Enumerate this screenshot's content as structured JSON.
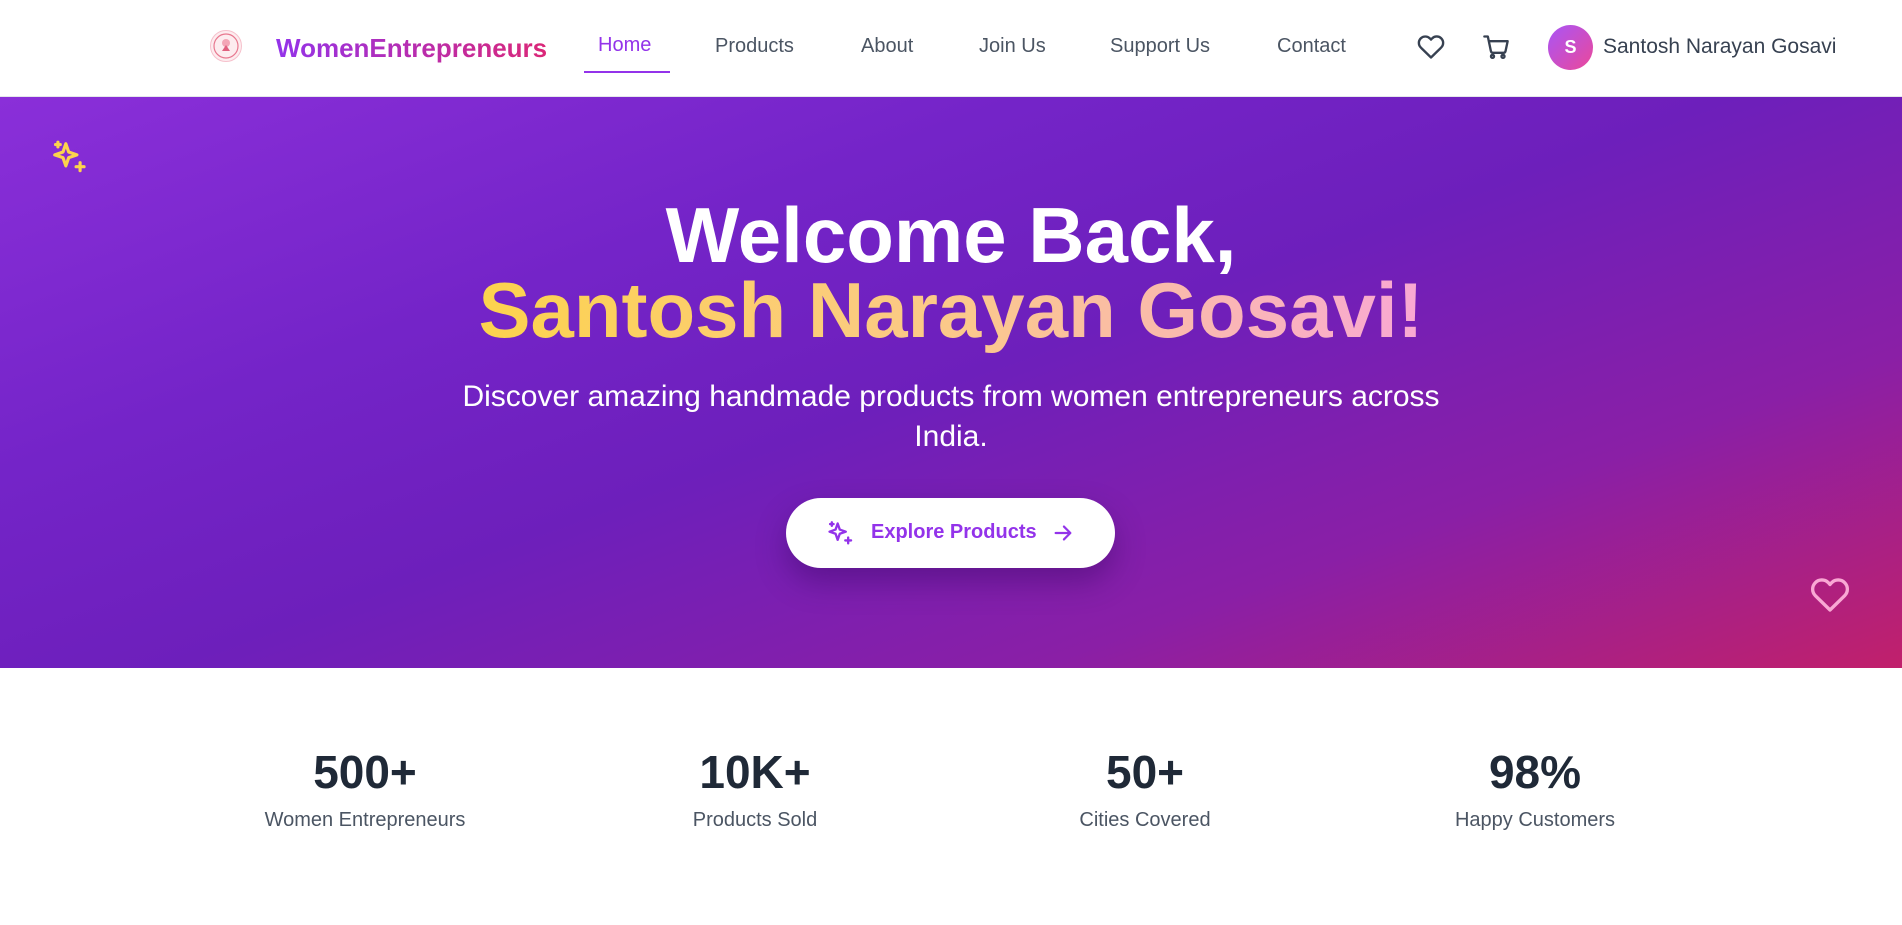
{
  "nav": {
    "brand": "WomenEntrepreneurs",
    "links": [
      "Home",
      "Products",
      "About",
      "Join Us",
      "Support Us",
      "Contact"
    ],
    "active": "Home",
    "icons": [
      "heart-icon",
      "cart-icon"
    ],
    "user": {
      "initial": "S",
      "name": "Santosh Narayan Gosavi"
    }
  },
  "hero": {
    "title_line1": "Welcome Back,",
    "title_line2": "Santosh Narayan Gosavi!",
    "subtitle": "Discover amazing handmade products from women entrepreneurs across India.",
    "cta_label": "Explore Products"
  },
  "stats": [
    {
      "value": "500+",
      "label": "Women Entrepreneurs"
    },
    {
      "value": "10K+",
      "label": "Products Sold"
    },
    {
      "value": "50+",
      "label": "Cities Covered"
    },
    {
      "value": "98%",
      "label": "Happy Customers"
    }
  ],
  "colors": {
    "accent": "#9333ea",
    "pink": "#db2777",
    "gold": "#fcd34d"
  }
}
